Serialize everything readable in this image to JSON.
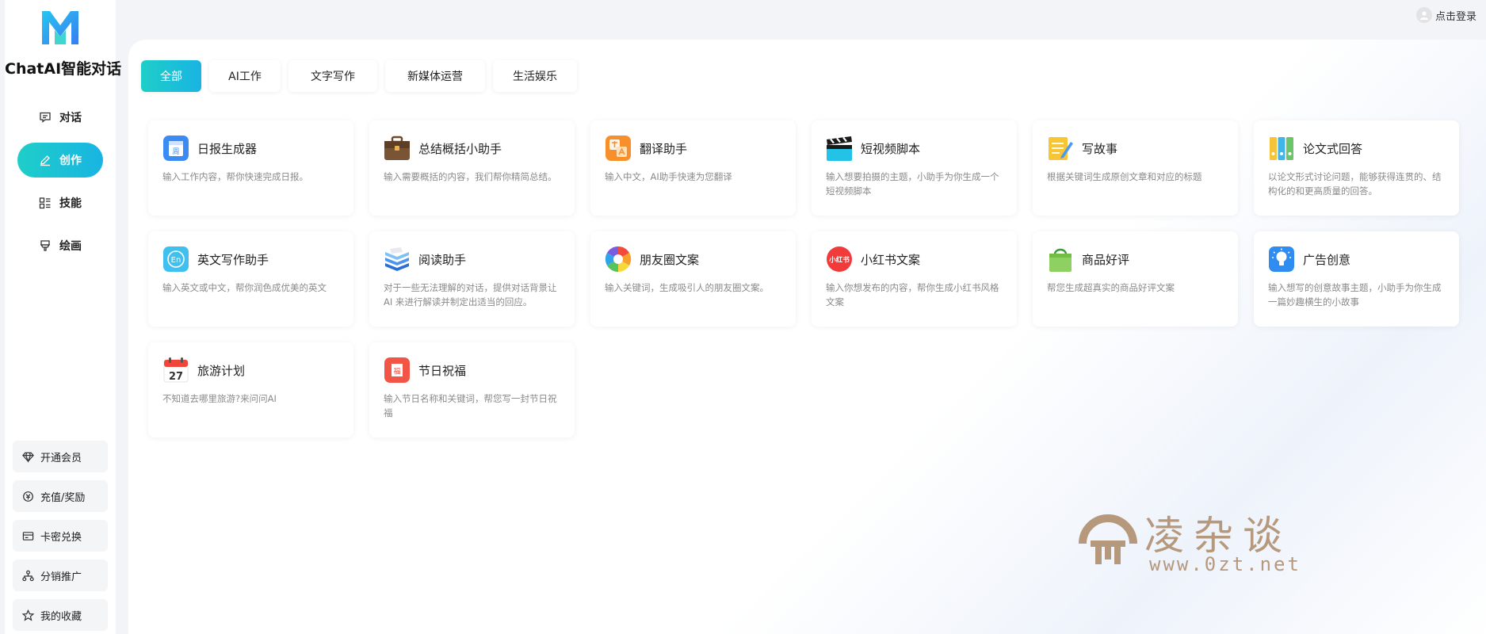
{
  "brand": {
    "name": "ChatAI智能对话"
  },
  "nav": [
    {
      "label": "对话",
      "icon": "chat-icon",
      "active": false
    },
    {
      "label": "创作",
      "icon": "pen-icon",
      "active": true
    },
    {
      "label": "技能",
      "icon": "skills-icon",
      "active": false
    },
    {
      "label": "绘画",
      "icon": "paint-icon",
      "active": false
    }
  ],
  "bottom_menu": [
    {
      "label": "开通会员",
      "icon": "diamond-icon"
    },
    {
      "label": "充值/奖励",
      "icon": "recharge-icon"
    },
    {
      "label": "卡密兑换",
      "icon": "card-icon"
    },
    {
      "label": "分销推广",
      "icon": "share-icon"
    },
    {
      "label": "我的收藏",
      "icon": "star-icon"
    }
  ],
  "header": {
    "login_label": "点击登录"
  },
  "tabs": [
    {
      "label": "全部",
      "active": true
    },
    {
      "label": "AI工作",
      "active": false
    },
    {
      "label": "文字写作",
      "active": false
    },
    {
      "label": "新媒体运营",
      "active": false
    },
    {
      "label": "生活娱乐",
      "active": false
    }
  ],
  "cards": [
    {
      "title": "日报生成器",
      "desc": "输入工作内容，帮你快速完成日报。",
      "icon": "daily-report-icon"
    },
    {
      "title": "总结概括小助手",
      "desc": "输入需要概括的内容，我们帮你精简总结。",
      "icon": "briefcase-icon"
    },
    {
      "title": "翻译助手",
      "desc": "输入中文，AI助手快速为您翻译",
      "icon": "translate-icon"
    },
    {
      "title": "短视频脚本",
      "desc": "输入想要拍摄的主题，小助手为你生成一个短视频脚本",
      "icon": "clapperboard-icon"
    },
    {
      "title": "写故事",
      "desc": "根据关键词生成原创文章和对应的标题",
      "icon": "notepad-icon"
    },
    {
      "title": "论文式回答",
      "desc": "以论文形式讨论问题，能够获得连贯的、结构化的和更高质量的回答。",
      "icon": "binders-icon"
    },
    {
      "title": "英文写作助手",
      "desc": "输入英文或中文，帮你润色成优美的英文",
      "icon": "english-icon"
    },
    {
      "title": "阅读助手",
      "desc": "对于一些无法理解的对话，提供对话背景让 AI 来进行解读并制定出适当的回应。",
      "icon": "books-icon"
    },
    {
      "title": "朋友圈文案",
      "desc": "输入关键词，生成吸引人的朋友圈文案。",
      "icon": "aperture-icon"
    },
    {
      "title": "小红书文案",
      "desc": "输入你想发布的内容，帮你生成小红书风格文案",
      "icon": "xiaohongshu-icon"
    },
    {
      "title": "商品好评",
      "desc": "帮您生成超真实的商品好评文案",
      "icon": "shopping-bag-icon"
    },
    {
      "title": "广告创意",
      "desc": "输入想写的创意故事主题，小助手为你生成一篇妙趣横生的小故事",
      "icon": "lightbulb-icon"
    },
    {
      "title": "旅游计划",
      "desc": "不知道去哪里旅游?来问问AI",
      "icon": "calendar-icon"
    },
    {
      "title": "节日祝福",
      "desc": "输入节日名称和关键词，帮您写一封节日祝福",
      "icon": "festival-icon"
    }
  ],
  "icon_labels": {
    "daily": "周",
    "english": "En",
    "calendar": "27",
    "xhs": "小红书",
    "festival": "福"
  },
  "watermark": {
    "text": "凌杂谈",
    "url": "www.0zt.net"
  },
  "colors": {
    "accent_start": "#1ecec8",
    "accent_end": "#19b4e3"
  }
}
